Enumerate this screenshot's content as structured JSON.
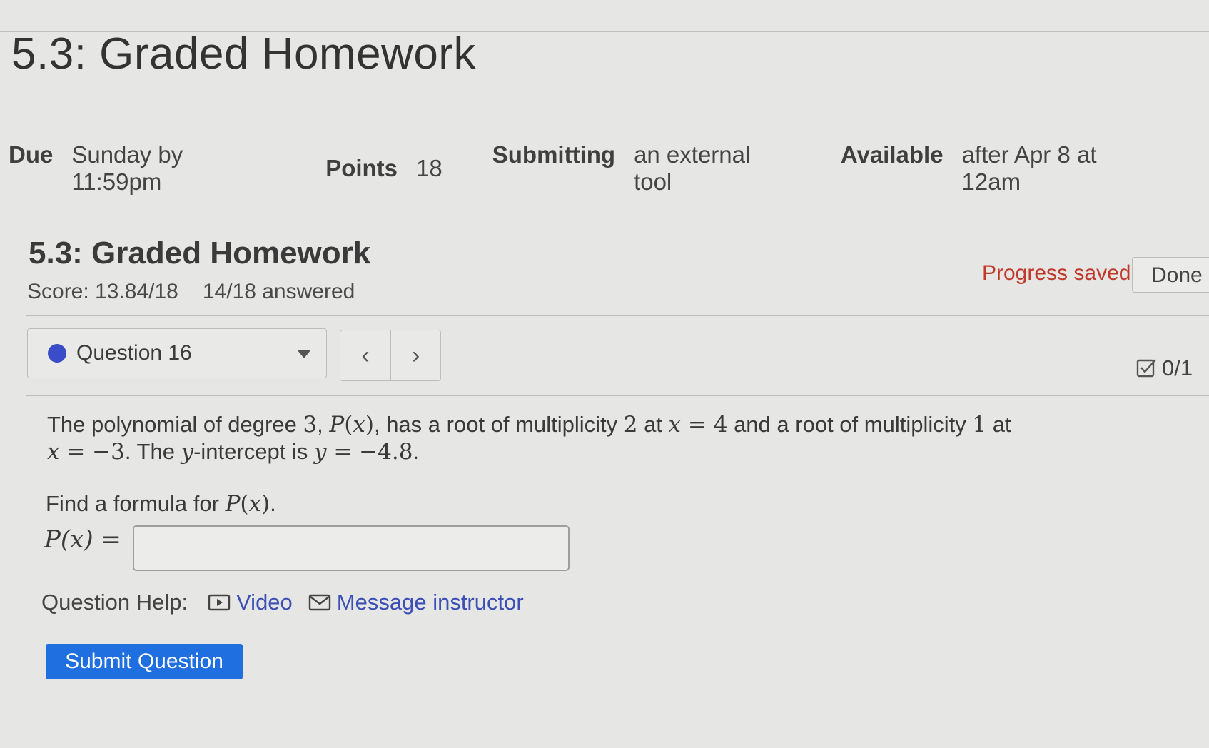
{
  "page_title": "5.3: Graded Homework",
  "meta": {
    "due_label": "Due",
    "due_value": "Sunday by 11:59pm",
    "points_label": "Points",
    "points_value": "18",
    "submitting_label": "Submitting",
    "submitting_value": "an external tool",
    "available_label": "Available",
    "available_value": "after Apr 8 at 12am"
  },
  "assignment": {
    "title": "5.3: Graded Homework",
    "score": "Score: 13.84/18",
    "answered": "14/18 answered",
    "progress_status": "Progress saved",
    "done_label": "Done"
  },
  "question_nav": {
    "selected": "Question 16",
    "prev_label": "‹",
    "next_label": "›",
    "question_score": "0/1"
  },
  "question": {
    "find_prefix": "Find a formula for",
    "answer_label": "P(x) =",
    "answer_value": ""
  },
  "help": {
    "label": "Question Help:",
    "video_label": "Video",
    "message_label": "Message instructor"
  },
  "submit_label": "Submit Question",
  "colors": {
    "accent": "#1f6fe0",
    "progress_saved": "#c0392b",
    "link": "#3c4fb5",
    "question_dot": "#3b4cc9"
  }
}
